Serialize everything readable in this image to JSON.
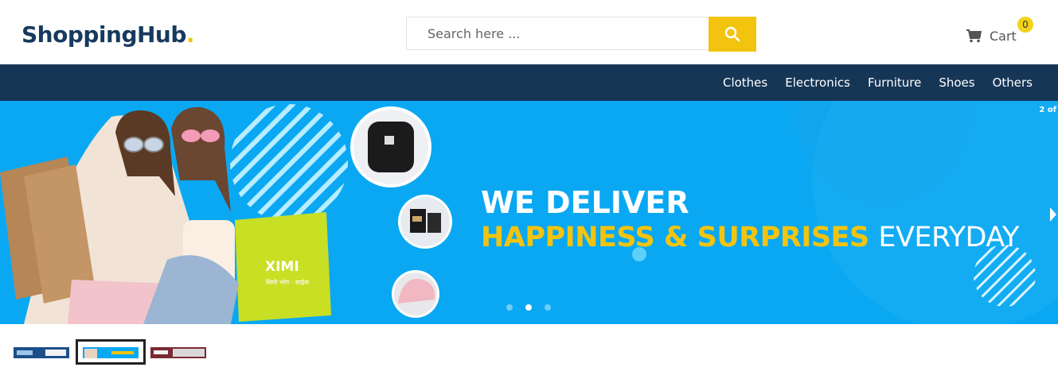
{
  "brand": {
    "name_main": "ShoppingHub",
    "name_accent": ".",
    "accent_color": "#f4c20d",
    "primary_color": "#163656"
  },
  "search": {
    "placeholder": "Search here ...",
    "button_icon": "search-icon"
  },
  "cart": {
    "label": "Cart",
    "count": "0",
    "icon": "cart-icon"
  },
  "nav": {
    "items": [
      "Clothes",
      "Electronics",
      "Furniture",
      "Shoes",
      "Others"
    ]
  },
  "banner": {
    "counter": "2 of",
    "headline_line1": "WE DELIVER",
    "headline_yellow": "HAPPINESS & SURPRISES",
    "headline_white": "EVERYDAY",
    "bag_text": "XIMI",
    "bag_subtext": "सिमी भोग · साईक",
    "active_slide": 2,
    "total_slides": 3,
    "bg_color": "#0aa8f2"
  },
  "thumbnails": [
    {
      "name": "slide-1-thumbnail",
      "color": "#1c4f8a"
    },
    {
      "name": "slide-2-thumbnail",
      "color": "#0aa8f2"
    },
    {
      "name": "slide-3-thumbnail",
      "color": "#7a2a33"
    }
  ]
}
